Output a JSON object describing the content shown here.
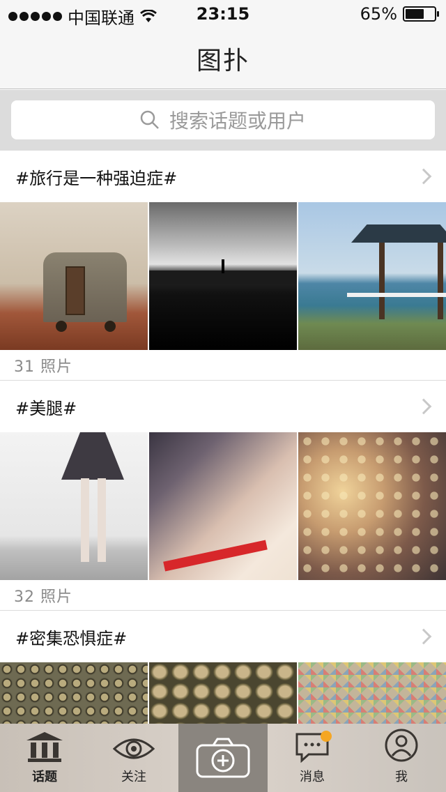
{
  "status_bar": {
    "carrier": "中国联通",
    "time": "23:15",
    "battery": "65%",
    "battery_level": 0.65
  },
  "nav": {
    "title": "图扑"
  },
  "search": {
    "placeholder": "搜索话题或用户"
  },
  "topics": [
    {
      "title": "#旅行是一种强迫症#",
      "count": "31 照片"
    },
    {
      "title": "#美腿#",
      "count": "32 照片"
    },
    {
      "title": "#密集恐惧症#"
    }
  ],
  "tab_bar": {
    "items": [
      {
        "label": "话题",
        "icon": "columns-icon",
        "active": true
      },
      {
        "label": "关注",
        "icon": "eye-icon"
      },
      {
        "label": "",
        "icon": "camera-plus-icon"
      },
      {
        "label": "消息",
        "icon": "chat-bubble-icon",
        "badge": true
      },
      {
        "label": "我",
        "icon": "person-icon"
      }
    ]
  },
  "colors": {
    "badge": "#f5a623",
    "camera_bg": "#8a857f"
  }
}
